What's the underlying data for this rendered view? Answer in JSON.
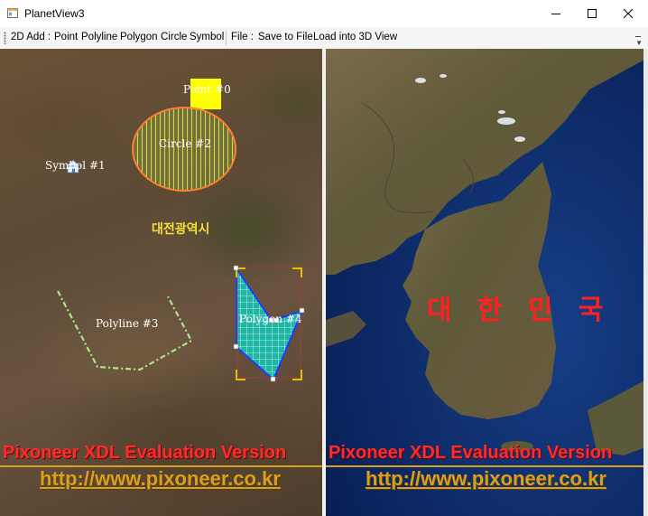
{
  "window": {
    "title": "PlanetView3",
    "minimize_symbol": "─",
    "maximize_symbol": "☐",
    "close_symbol": "✕"
  },
  "toolbar": {
    "add_label": "2D Add :",
    "items": [
      "Point",
      "Polyline",
      "Polygon",
      "Circle",
      "Symbol"
    ],
    "file_label": "File :",
    "save_label": "Save to File",
    "load_label": "Load into 3D View"
  },
  "map2d": {
    "point_label": "Point #0",
    "circle_label": "Circle #2",
    "symbol_label": "Symbol #1",
    "polyline_label": "Polyline #3",
    "polygon_label": "Polygon #4",
    "city_label": "대전광역시",
    "colors": {
      "point": "#ffff00",
      "circle_stroke": "#ff8030",
      "polyline": "#a8e88a",
      "polygon_fill": "#1fb6a6",
      "polygon_stroke": "#1a3cff",
      "selection": "#e8c000"
    }
  },
  "map3d": {
    "country_label": "대 한 민 국"
  },
  "watermark": {
    "title": "Pixoneer XDL Evaluation Version",
    "url": "http://www.pixoneer.co.kr"
  }
}
